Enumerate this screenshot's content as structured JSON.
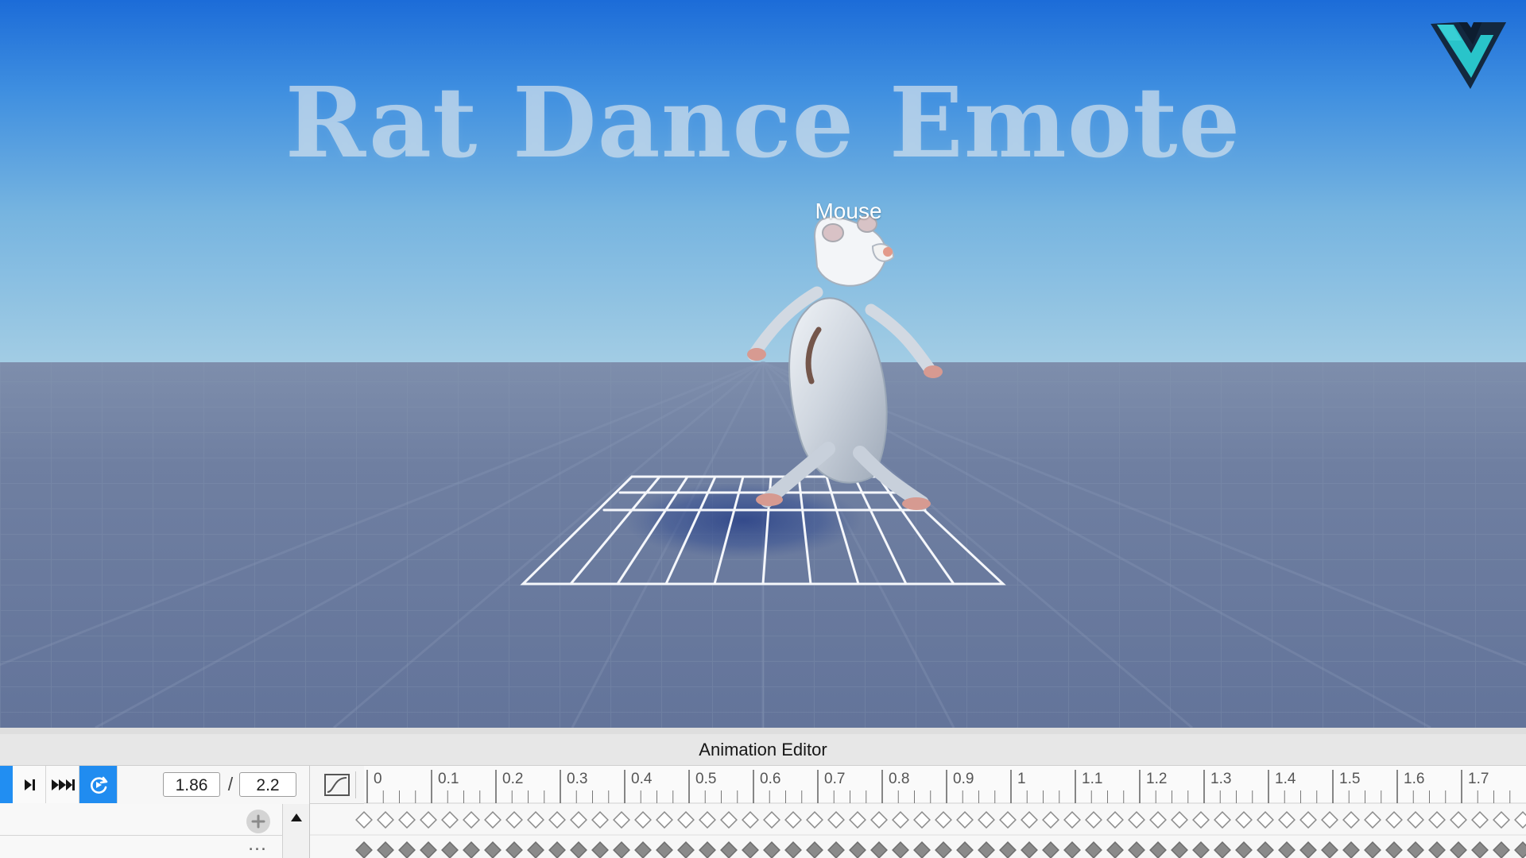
{
  "overlay": {
    "title": "Rat Dance Emote",
    "character_name": "Mouse"
  },
  "logo": {
    "icon": "triangle-shield-logo-icon",
    "colors": {
      "dark": "#13283f",
      "teal": "#29c4ca"
    }
  },
  "editor": {
    "title": "Animation Editor",
    "current_time": "1.86",
    "total_time": "2.2",
    "separator": "/",
    "controls": {
      "step_forward_icon": "step-forward-icon",
      "skip_to_end_icon": "skip-to-end-icon",
      "loop_icon": "loop-icon",
      "curve_editor_icon": "curve-editor-icon",
      "add_track_icon": "plus-icon",
      "scroll_up_icon": "scroll-up-icon"
    },
    "more": "...",
    "timeline": {
      "tick_labels": [
        "0",
        "0.1",
        "0.2",
        "0.3",
        "0.4",
        "0.5",
        "0.6",
        "0.7",
        "0.8",
        "0.9",
        "1",
        "1.1",
        "1.2",
        "1.3",
        "1.4",
        "1.5",
        "1.6",
        "1.7"
      ],
      "visible_keyframe_count": 55
    },
    "colors": {
      "accent_blue": "#208cf0",
      "panel_bg": "#f5f5f5",
      "keyframe_gray": "#8a8a8a"
    }
  }
}
